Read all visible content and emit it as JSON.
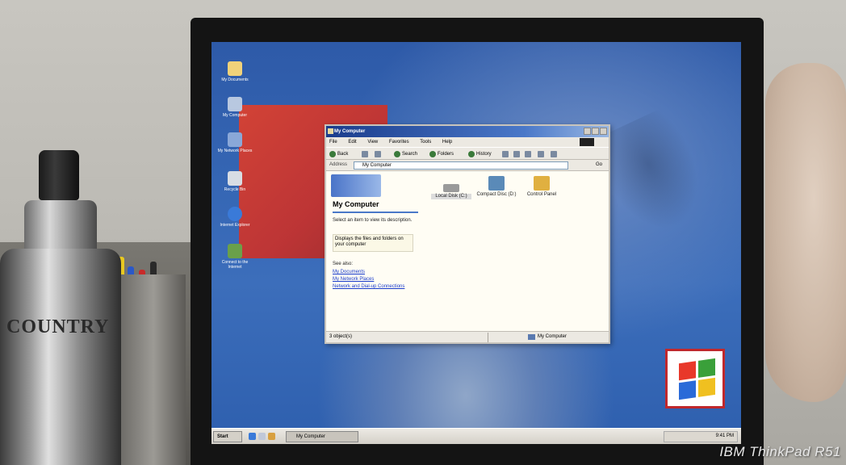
{
  "window": {
    "title": "My Computer",
    "menu": [
      "File",
      "Edit",
      "View",
      "Favorites",
      "Tools",
      "Help"
    ],
    "toolbar": {
      "back": "Back",
      "search": "Search",
      "folders": "Folders",
      "history": "History"
    },
    "address_label": "Address",
    "address_value": "My Computer",
    "go_label": "Go",
    "left_pane": {
      "title": "My Computer",
      "hint": "Select an item to view its description.",
      "note": "Displays the files and folders on your computer",
      "see_also": "See also:",
      "links": [
        "My Documents",
        "My Network Places",
        "Network and Dial-up Connections"
      ]
    },
    "items": [
      {
        "label": "Local Disk (C:)",
        "icon": "drive-icon"
      },
      {
        "label": "Compact Disc (D:)",
        "icon": "cd-drive-icon"
      },
      {
        "label": "Control Panel",
        "icon": "control-panel-icon"
      }
    ],
    "status_left": "3 object(s)",
    "status_right": "My Computer"
  },
  "desktop_icons": [
    {
      "label": "My Documents",
      "icon": "my-documents-icon",
      "color": "#f0d27a"
    },
    {
      "label": "My Computer",
      "icon": "my-computer-icon",
      "color": "#b8c8e0"
    },
    {
      "label": "My Network Places",
      "icon": "network-places-icon",
      "color": "#8aa8d8"
    },
    {
      "label": "Recycle Bin",
      "icon": "recycle-bin-icon",
      "color": "#d8dde4"
    },
    {
      "label": "Internet Explorer",
      "icon": "internet-explorer-icon",
      "color": "#3a7ad8"
    },
    {
      "label": "Connect to the Internet",
      "icon": "connect-internet-icon",
      "color": "#6aa04a"
    }
  ],
  "taskbar": {
    "start_label": "Start",
    "task_label": "My Computer",
    "clock": "9:41 PM"
  },
  "watermark": "IBM ThinkPad R51",
  "bottle_text": "COUNTRY",
  "colors": {
    "desktop_blue": "#3566b4",
    "title_bar": "#1a3c8c",
    "red_block": "#d33a2a",
    "link": "#1a3ccc"
  }
}
